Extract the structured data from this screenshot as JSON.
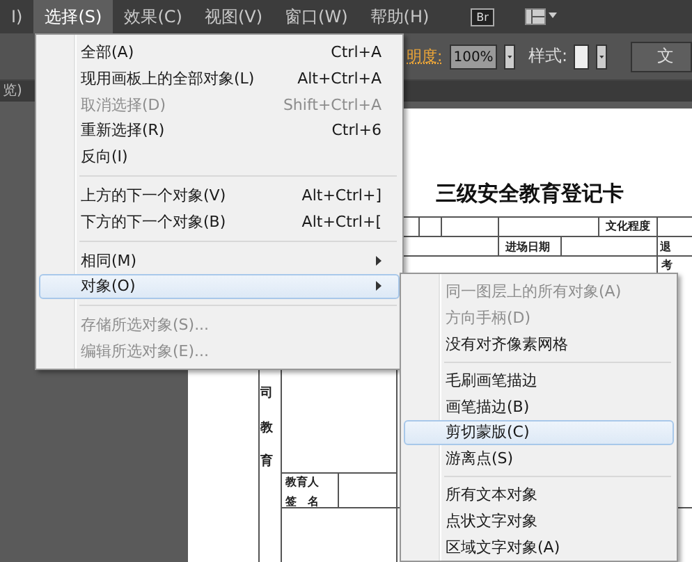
{
  "menubar": {
    "items": [
      {
        "label": "I)",
        "selected": false
      },
      {
        "label": "选择(S)",
        "selected": true
      },
      {
        "label": "效果(C)",
        "selected": false
      },
      {
        "label": "视图(V)",
        "selected": false
      },
      {
        "label": "窗口(W)",
        "selected": false
      },
      {
        "label": "帮助(H)",
        "selected": false
      }
    ],
    "bridge_button": "Br"
  },
  "control_bar": {
    "opacity_label": "明度:",
    "opacity_value": "100%",
    "style_label": "样式:",
    "document_button": "文"
  },
  "tab_strip": {
    "tab": "览)"
  },
  "document": {
    "title": "三级安全教育登记卡",
    "cells": [
      {
        "kind": "h",
        "text": "文化程度"
      },
      {
        "kind": "h",
        "text": "进场日期"
      },
      {
        "kind": "h",
        "text": "退"
      },
      {
        "kind": "h",
        "text": "考"
      },
      {
        "kind": "v",
        "text": "司教育"
      },
      {
        "kind": "h",
        "text": "教育人"
      },
      {
        "kind": "h",
        "text": "签　名"
      }
    ]
  },
  "menu": {
    "items": [
      {
        "kind": "item",
        "label": "全部(A)",
        "shortcut": "Ctrl+A",
        "disabled": false,
        "submenu": false,
        "selected": false
      },
      {
        "kind": "item",
        "label": "现用画板上的全部对象(L)",
        "shortcut": "Alt+Ctrl+A",
        "disabled": false,
        "submenu": false,
        "selected": false
      },
      {
        "kind": "item",
        "label": "取消选择(D)",
        "shortcut": "Shift+Ctrl+A",
        "disabled": true,
        "submenu": false,
        "selected": false
      },
      {
        "kind": "item",
        "label": "重新选择(R)",
        "shortcut": "Ctrl+6",
        "disabled": false,
        "submenu": false,
        "selected": false
      },
      {
        "kind": "item",
        "label": "反向(I)",
        "disabled": false,
        "submenu": false,
        "selected": false
      },
      {
        "kind": "separator"
      },
      {
        "kind": "item",
        "label": "上方的下一个对象(V)",
        "shortcut": "Alt+Ctrl+]",
        "disabled": false,
        "submenu": false,
        "selected": false
      },
      {
        "kind": "item",
        "label": "下方的下一个对象(B)",
        "shortcut": "Alt+Ctrl+[",
        "disabled": false,
        "submenu": false,
        "selected": false
      },
      {
        "kind": "separator"
      },
      {
        "kind": "item",
        "label": "相同(M)",
        "disabled": false,
        "submenu": true,
        "selected": false
      },
      {
        "kind": "item",
        "label": "对象(O)",
        "disabled": false,
        "submenu": true,
        "selected": true
      },
      {
        "kind": "separator"
      },
      {
        "kind": "item",
        "label": "存储所选对象(S)...",
        "disabled": true,
        "submenu": false,
        "selected": false
      },
      {
        "kind": "item",
        "label": "编辑所选对象(E)...",
        "disabled": true,
        "submenu": false,
        "selected": false
      }
    ]
  },
  "submenu": {
    "items": [
      {
        "kind": "item",
        "label": "同一图层上的所有对象(A)",
        "disabled": true,
        "selected": false
      },
      {
        "kind": "item",
        "label": "方向手柄(D)",
        "disabled": true,
        "selected": false
      },
      {
        "kind": "item",
        "label": "没有对齐像素网格",
        "disabled": false,
        "selected": false
      },
      {
        "kind": "separator"
      },
      {
        "kind": "item",
        "label": "毛刷画笔描边",
        "disabled": false,
        "selected": false
      },
      {
        "kind": "item",
        "label": "画笔描边(B)",
        "disabled": false,
        "selected": false
      },
      {
        "kind": "item",
        "label": "剪切蒙版(C)",
        "disabled": false,
        "selected": true
      },
      {
        "kind": "item",
        "label": "游离点(S)",
        "disabled": false,
        "selected": false
      },
      {
        "kind": "separator"
      },
      {
        "kind": "item",
        "label": "所有文本对象",
        "disabled": false,
        "selected": false
      },
      {
        "kind": "item",
        "label": "点状文字对象",
        "disabled": false,
        "selected": false
      },
      {
        "kind": "item",
        "label": "区域文字对象(A)",
        "disabled": false,
        "selected": false
      }
    ]
  }
}
